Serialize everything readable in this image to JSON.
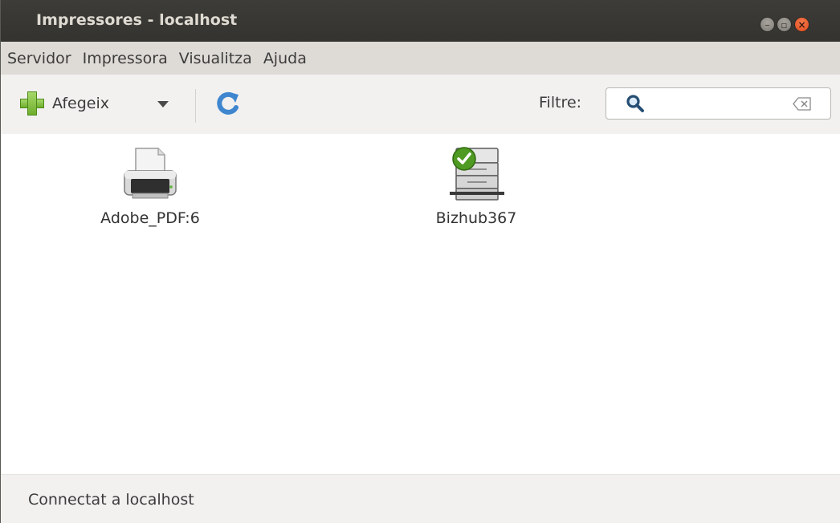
{
  "window": {
    "title": "Impressores - localhost"
  },
  "menubar": {
    "items": [
      "Servidor",
      "Impressora",
      "Visualitza",
      "Ajuda"
    ]
  },
  "toolbar": {
    "add_label": "Afegeix",
    "filter_label": "Filtre:",
    "search_value": ""
  },
  "printers": [
    {
      "name": "Adobe_PDF:6",
      "icon": "printer-icon",
      "default": false
    },
    {
      "name": "Bizhub367",
      "icon": "network-printer-icon",
      "default": true
    }
  ],
  "status": {
    "text": "Connectat a localhost"
  },
  "colors": {
    "titlebar": "#3a3935",
    "menubar": "#dedbd7",
    "toolbar": "#f2f1f0",
    "close": "#e8552a",
    "accent_green": "#6fae2d"
  }
}
